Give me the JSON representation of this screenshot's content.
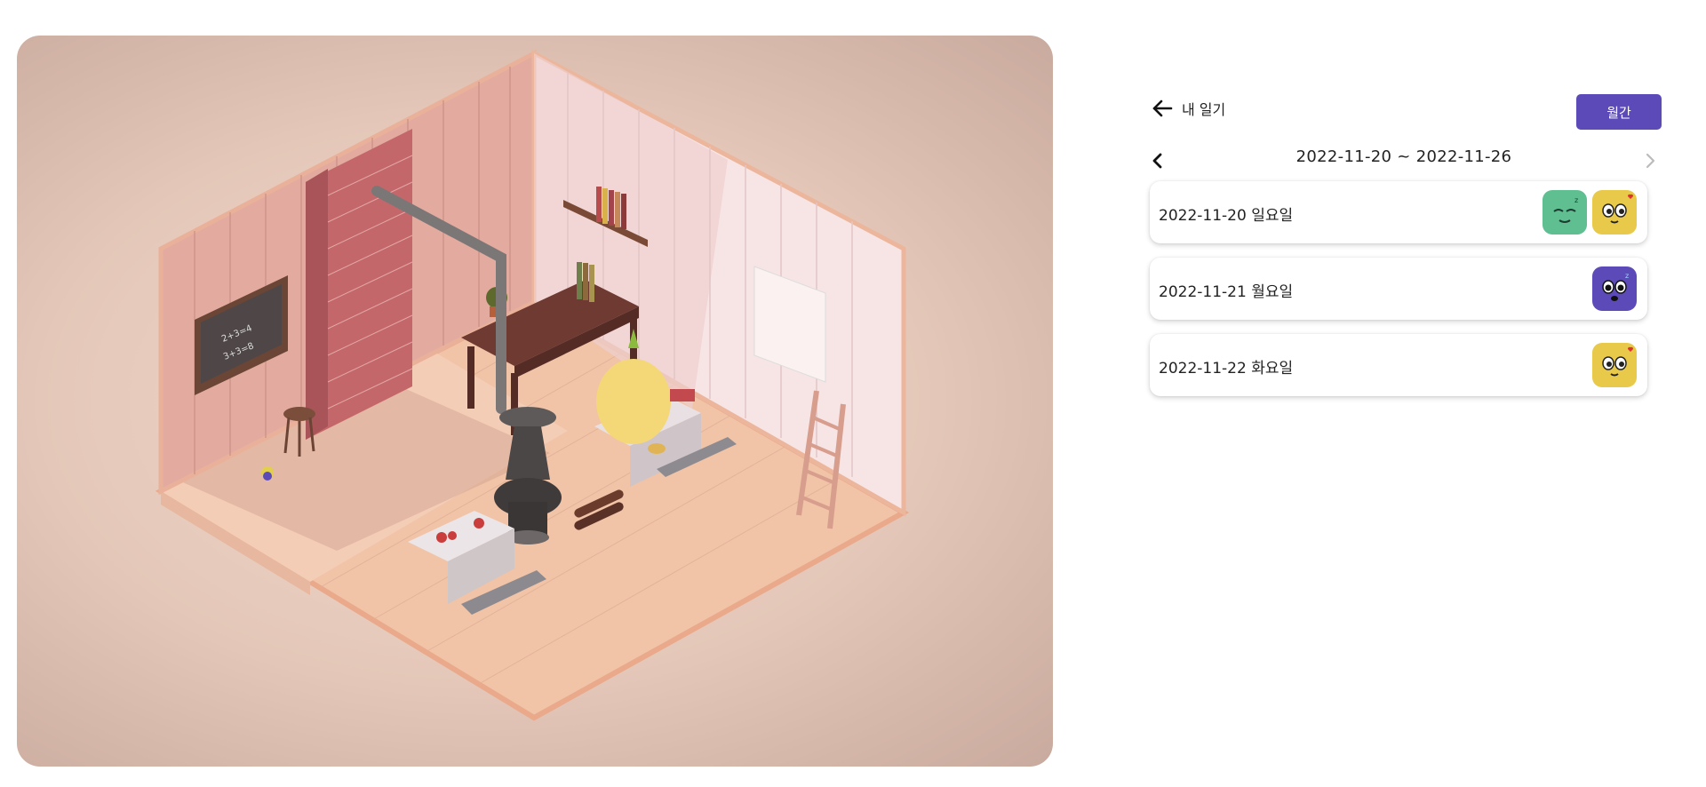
{
  "header": {
    "back_label": "내 일기",
    "monthly_button": "월간"
  },
  "range": {
    "text": "2022-11-20 ~ 2022-11-26"
  },
  "entries": [
    {
      "date": "2022-11-20 일요일",
      "moods": [
        "green-calm-face-icon",
        "yellow-love-face-icon"
      ]
    },
    {
      "date": "2022-11-21 월요일",
      "moods": [
        "purple-surprised-face-icon"
      ]
    },
    {
      "date": "2022-11-22 화요일",
      "moods": [
        "yellow-love-face-icon"
      ]
    }
  ],
  "colors": {
    "accent": "#5b4ab7",
    "mood_green": "#5fbf91",
    "mood_yellow": "#e8c94a",
    "mood_purple": "#5b4ab7"
  },
  "scene": {
    "chalkboard_text": "2+3=4\n3+3=8"
  }
}
